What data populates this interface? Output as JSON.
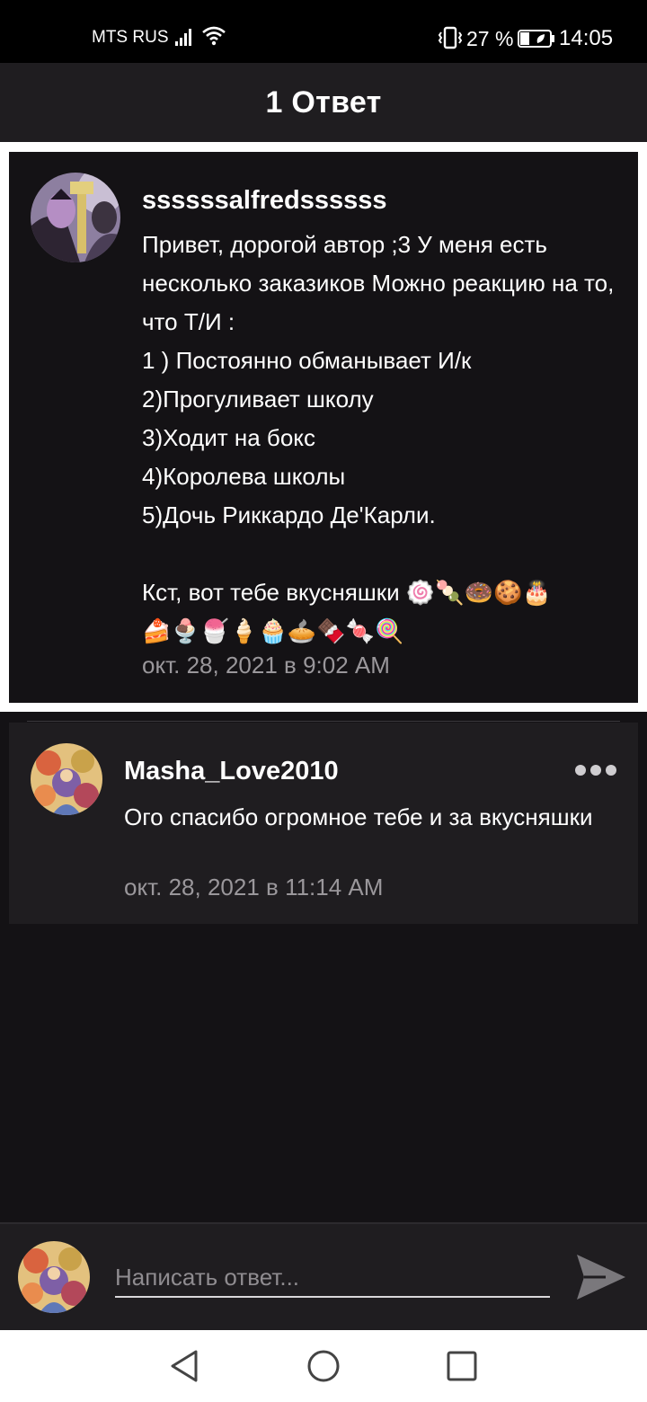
{
  "status_bar": {
    "carrier": "MTS RUS",
    "battery_percent": "27 %",
    "time": "14:05"
  },
  "header": {
    "title": "1 Ответ"
  },
  "original_comment": {
    "username": "ssssssalfredssssss",
    "text": "Привет, дорогой автор ;3 У меня есть несколько заказиков Можно реакцию на то, что Т/И :\n1 ) Постоянно обманывает И/к\n2)Прогуливает школу\n3)Ходит на бокс\n4)Королева школы\n5)Дочь Риккардо Де'Карли.\n\nКст, вот тебе вкусняшки 🍥🍡🍩🍪🎂\n🍰🍨🍧🍦🧁🥧🍫🍬🍭",
    "date": "окт. 28, 2021 в 9:02 AM"
  },
  "reply": {
    "username": "Masha_Love2010",
    "text": "Ого спасибо огромное тебе и за вкусняшки",
    "date": "окт. 28, 2021 в 11:14 AM"
  },
  "composer": {
    "placeholder": "Написать ответ..."
  },
  "colors": {
    "background": "#141215",
    "card": "#1f1d20",
    "muted_text": "#9a979b"
  },
  "icons": {
    "more": "more-dots-icon",
    "send": "send-icon",
    "back": "back-triangle-icon",
    "home": "home-circle-icon",
    "recents": "recents-square-icon"
  }
}
